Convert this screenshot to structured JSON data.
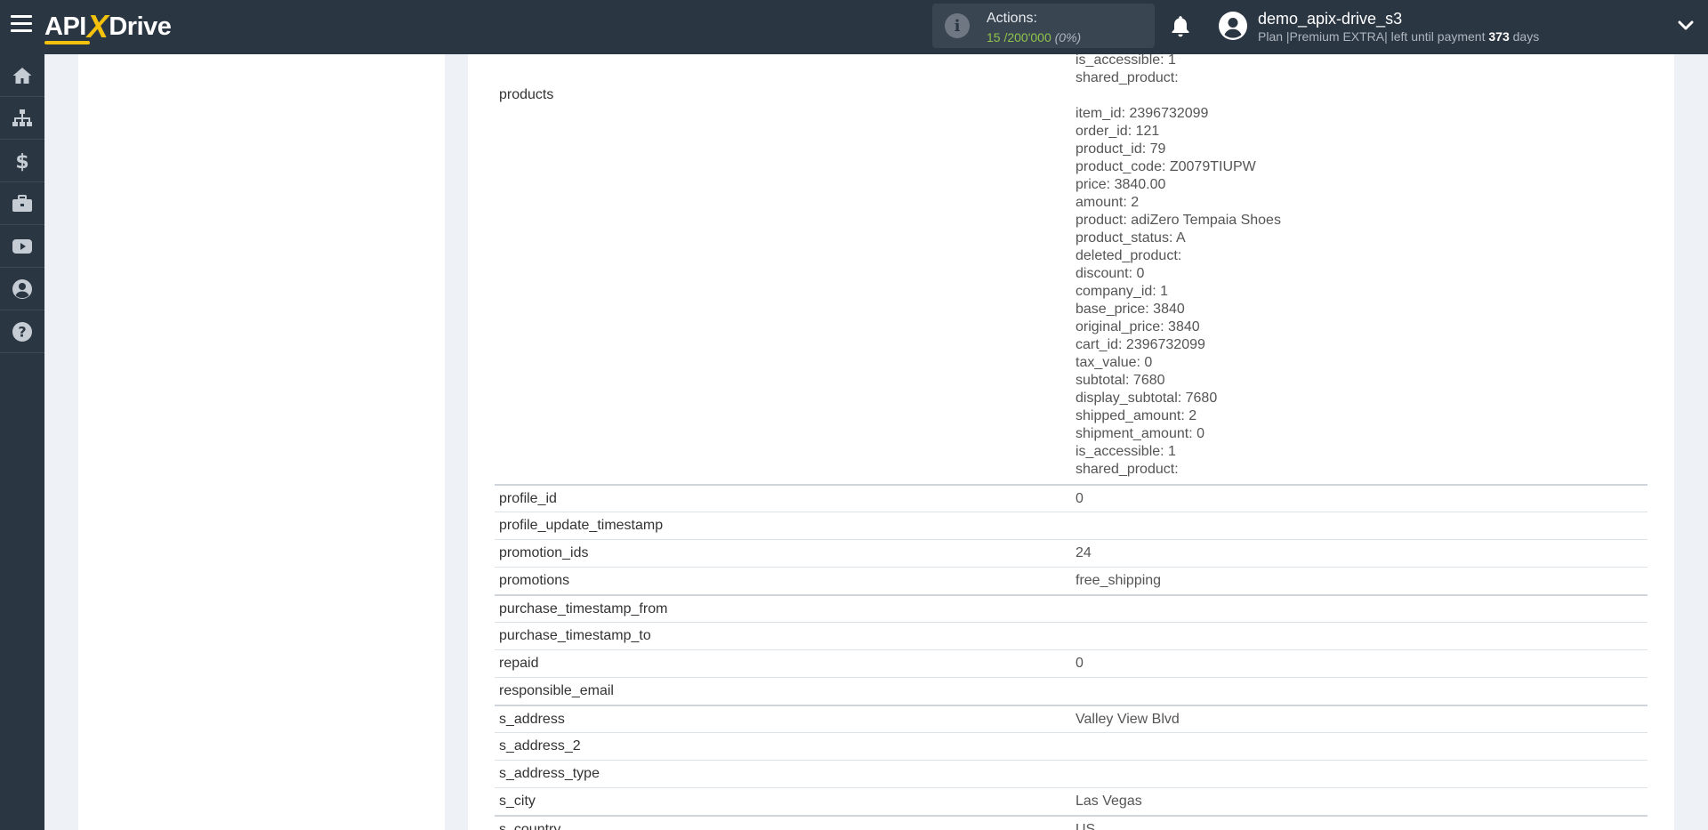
{
  "header": {
    "logo": {
      "part1": "API",
      "part2": "X",
      "part3": "Drive"
    },
    "actions": {
      "label": "Actions:",
      "used": "15",
      "separator": "/",
      "limit": "200'000",
      "percent": "(0%)"
    },
    "user": {
      "name": "demo_apix-drive_s3",
      "plan_prefix": "Plan |Premium EXTRA| left until payment",
      "days_count": "373",
      "days_label": "days"
    },
    "colors": {
      "bar": "#2b3643",
      "accent": "#f4c20d",
      "actions_used": "#8fc34c"
    }
  },
  "sidebar": {
    "items": [
      {
        "icon": "home-icon"
      },
      {
        "icon": "sitemap-icon"
      },
      {
        "icon": "dollar-icon"
      },
      {
        "icon": "briefcase-icon"
      },
      {
        "icon": "youtube-icon"
      },
      {
        "icon": "user-circle-icon"
      },
      {
        "icon": "question-icon"
      }
    ]
  },
  "products": {
    "label": "products",
    "lines": [
      "is_accessible: 1",
      "shared_product:",
      "",
      "item_id: 2396732099",
      "order_id: 121",
      "product_id: 79",
      "product_code: Z0079TIUPW",
      "price: 3840.00",
      "amount: 2",
      "product: adiZero Tempaia Shoes",
      "product_status: A",
      "deleted_product:",
      "discount: 0",
      "company_id: 1",
      "base_price: 3840",
      "original_price: 3840",
      "cart_id: 2396732099",
      "tax_value: 0",
      "subtotal: 7680",
      "display_subtotal: 7680",
      "shipped_amount: 2",
      "shipment_amount: 0",
      "is_accessible: 1",
      "shared_product:"
    ]
  },
  "rows": [
    {
      "key": "profile_id",
      "value": "0"
    },
    {
      "key": "profile_update_timestamp",
      "value": ""
    },
    {
      "key": "promotion_ids",
      "value": "24"
    },
    {
      "key": "promotions",
      "value": "free_shipping"
    },
    {
      "key": "purchase_timestamp_from",
      "value": ""
    },
    {
      "key": "purchase_timestamp_to",
      "value": ""
    },
    {
      "key": "repaid",
      "value": "0"
    },
    {
      "key": "responsible_email",
      "value": ""
    },
    {
      "key": "s_address",
      "value": "Valley View Blvd"
    },
    {
      "key": "s_address_2",
      "value": ""
    },
    {
      "key": "s_address_type",
      "value": ""
    },
    {
      "key": "s_city",
      "value": "Las Vegas"
    },
    {
      "key": "s_country",
      "value": "US"
    }
  ]
}
